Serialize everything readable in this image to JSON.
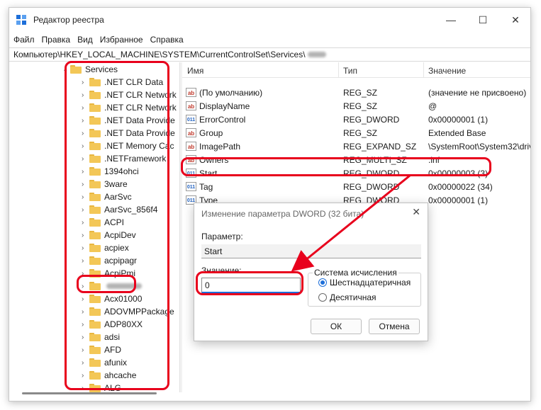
{
  "window": {
    "title": "Редактор реестра",
    "controls": {
      "minimize": "—",
      "maximize": "☐",
      "close": "✕"
    }
  },
  "menu": [
    "Файл",
    "Правка",
    "Вид",
    "Избранное",
    "Справка"
  ],
  "address": "Компьютер\\HKEY_LOCAL_MACHINE\\SYSTEM\\CurrentControlSet\\Services\\",
  "tree": {
    "parent": "Services",
    "items": [
      ".NET CLR Data",
      ".NET CLR Network",
      ".NET CLR Network",
      ".NET Data Provide",
      ".NET Data Provide",
      ".NET Memory Cac",
      ".NETFramework",
      "1394ohci",
      "3ware",
      "AarSvc",
      "AarSvc_856f4",
      "ACPI",
      "AcpiDev",
      "acpiex",
      "acpipagr",
      "AcpiPmi",
      "",
      "Acx01000",
      "ADOVMPPackage",
      "ADP80XX",
      "adsi",
      "AFD",
      "afunix",
      "ahcache",
      "ALG"
    ]
  },
  "values": {
    "columns": {
      "name": "Имя",
      "type": "Тип",
      "data": "Значение"
    },
    "rows": [
      {
        "icon": "ab",
        "name": "(По умолчанию)",
        "type": "REG_SZ",
        "data": "(значение не присвоено)"
      },
      {
        "icon": "ab",
        "name": "DisplayName",
        "type": "REG_SZ",
        "data": "@"
      },
      {
        "icon": "dw",
        "name": "ErrorControl",
        "type": "REG_DWORD",
        "data": "0x00000001 (1)"
      },
      {
        "icon": "ab",
        "name": "Group",
        "type": "REG_SZ",
        "data": "Extended Base"
      },
      {
        "icon": "ab",
        "name": "ImagePath",
        "type": "REG_EXPAND_SZ",
        "data": "\\SystemRoot\\System32\\driv"
      },
      {
        "icon": "ab",
        "name": "Owners",
        "type": "REG_MULTI_SZ",
        "data": ".inf"
      },
      {
        "icon": "dw",
        "name": "Start",
        "type": "REG_DWORD",
        "data": "0x00000003 (3)"
      },
      {
        "icon": "dw",
        "name": "Tag",
        "type": "REG_DWORD",
        "data": "0x00000022 (34)"
      },
      {
        "icon": "dw",
        "name": "Type",
        "type": "REG_DWORD",
        "data": "0x00000001 (1)"
      }
    ]
  },
  "dialog": {
    "title": "Изменение параметра DWORD (32 бита)",
    "close": "✕",
    "param_label": "Параметр:",
    "param_value": "Start",
    "value_label": "Значение:",
    "value": "0",
    "base_label": "Система исчисления",
    "hex_label": "Шестнадцатеричная",
    "dec_label": "Десятичная",
    "ok": "ОК",
    "cancel": "Отмена"
  },
  "colors": {
    "highlight": "#e8001c",
    "accent": "#1e6fd9",
    "folder": "#f3c757"
  }
}
